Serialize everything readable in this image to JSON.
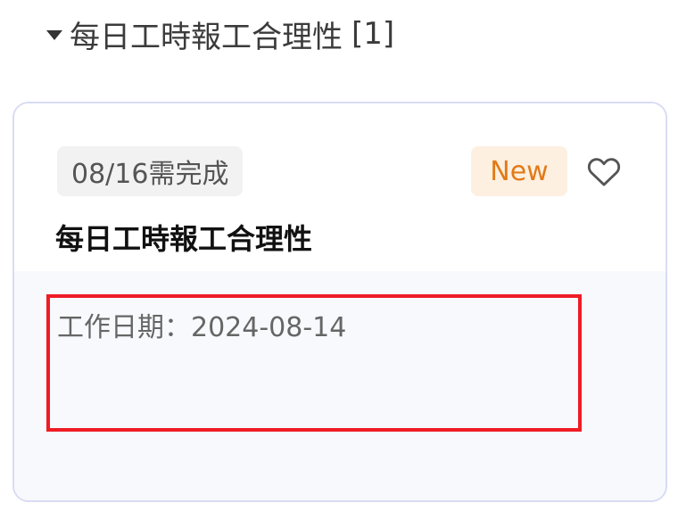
{
  "section": {
    "title": "每日工時報工合理性",
    "count": "[1]"
  },
  "card": {
    "due_label": "08/16需完成",
    "badge": "New",
    "title": "每日工時報工合理性",
    "work_date": "工作日期：2024-08-14"
  },
  "icons": {
    "collapse": "caret-down-icon",
    "favorite": "heart-outline-icon"
  },
  "colors": {
    "badge_text": "#e27a16",
    "badge_bg": "#fdf0e1",
    "highlight": "#ee1c25",
    "card_border": "#d9dcf3"
  }
}
